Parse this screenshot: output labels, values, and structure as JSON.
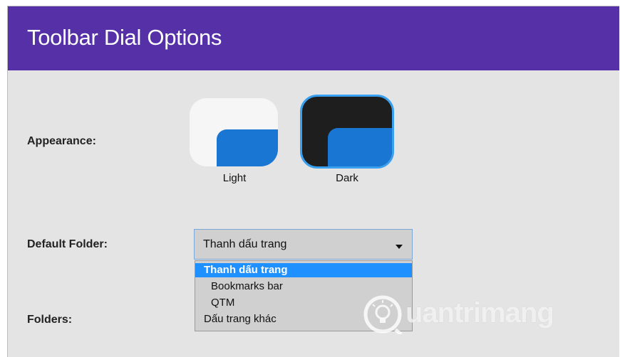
{
  "header": {
    "title": "Toolbar Dial Options"
  },
  "appearance": {
    "label": "Appearance:",
    "options": [
      {
        "name": "Light",
        "selected": false
      },
      {
        "name": "Dark",
        "selected": true
      }
    ]
  },
  "default_folder": {
    "label": "Default Folder:",
    "value": "Thanh dấu trang",
    "options": [
      "Thanh dấu trang",
      "Bookmarks bar",
      "QTM",
      "Dấu trang khác"
    ]
  },
  "folders": {
    "label": "Folders:"
  },
  "watermark": {
    "text": "uantrimang"
  },
  "colors": {
    "header_bg": "#5530a6",
    "accent_blue": "#1976d2",
    "selected_option": "#1e90ff",
    "selected_border": "#39a0ef"
  }
}
